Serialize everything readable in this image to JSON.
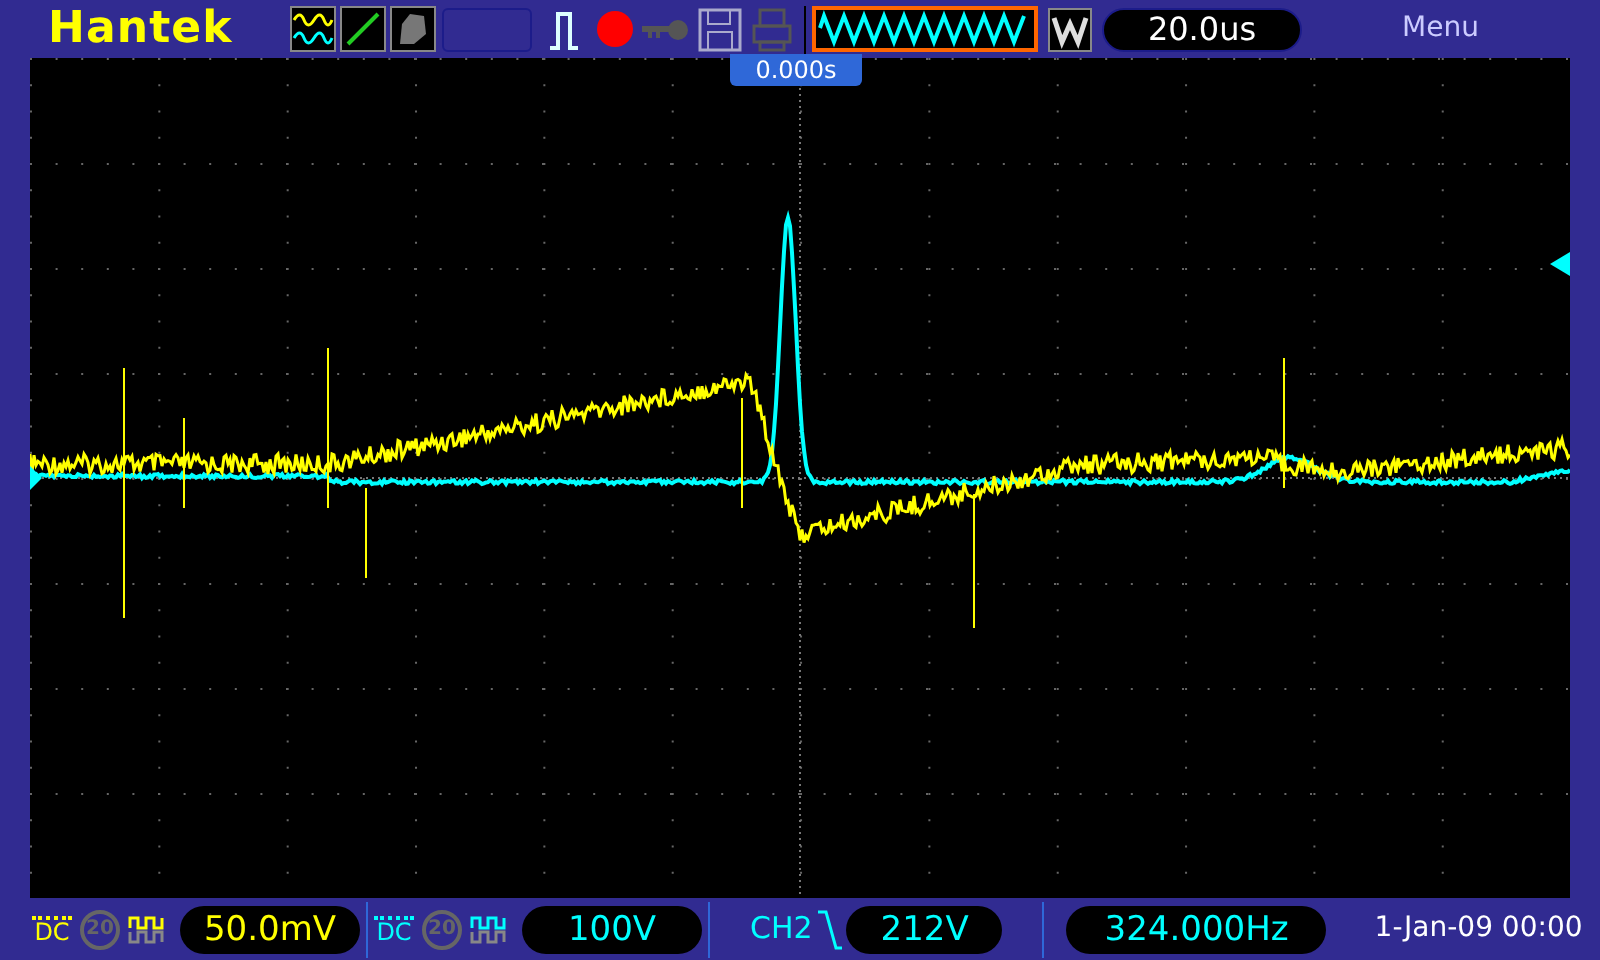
{
  "brand": "Hantek",
  "top_bar": {
    "timebase": "20.0us",
    "menu": "Menu"
  },
  "display": {
    "trigger_position": "0.000s"
  },
  "channels": [
    {
      "coupling": "DC",
      "bandwidth_limit": "20",
      "volts_per_div": "50.0mV",
      "color": "#ffff00"
    },
    {
      "coupling": "DC",
      "bandwidth_limit": "20",
      "volts_per_div": "100V",
      "color": "#00ffff"
    }
  ],
  "trigger": {
    "source": "CH2",
    "level": "212V",
    "frequency": "324.000Hz"
  },
  "date_time": "1-Jan-09 00:00"
}
